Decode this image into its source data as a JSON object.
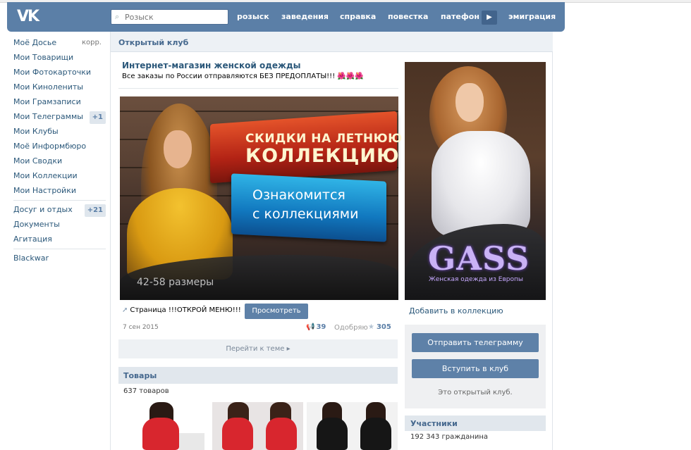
{
  "header": {
    "search_placeholder": "Розыск",
    "nav": [
      "розыск",
      "заведения",
      "справка",
      "повестка",
      "патефон",
      "эмиграция"
    ]
  },
  "sidebar": {
    "items": [
      {
        "label": "Моё Досье",
        "extra": "корр."
      },
      {
        "label": "Мои Товарищи"
      },
      {
        "label": "Мои Фотокарточки"
      },
      {
        "label": "Мои Кинолениты"
      },
      {
        "label": "Мои Грамзаписи"
      },
      {
        "label": "Мои Телеграммы",
        "badge": "+1"
      },
      {
        "label": "Мои Клубы"
      },
      {
        "label": "Моё Информбюро"
      },
      {
        "label": "Мои Сводки"
      },
      {
        "label": "Мои Коллекции"
      },
      {
        "label": "Мои Настройки"
      }
    ],
    "items2": [
      {
        "label": "Досуг и отдых",
        "badge": "+21"
      },
      {
        "label": "Документы"
      },
      {
        "label": "Агитация"
      }
    ],
    "items3": [
      {
        "label": "Blackwar"
      }
    ]
  },
  "main": {
    "header_title": "Открытый клуб",
    "club_title": "Интернет-магазин женской одежды",
    "club_status": "Все заказы по России отправляются БЕЗ ПРЕДОПЛАТЫ!!! 🌺🌺🌺",
    "banner": {
      "line1": "СКИДКИ НА ЛЕТНЮЮ",
      "line2": "КОЛЛЕКЦИЮ",
      "line3": "Ознакомится",
      "line4": "с коллекциями",
      "sizes": "42-58 размеры"
    },
    "page_link": "Страница !!!ОТКРОЙ МЕНЮ!!!",
    "view_button": "Просмотреть",
    "post_date": "7 сен 2015",
    "share_count": "39",
    "like_label": "Одобряю",
    "like_count": "305",
    "goto": "Перейти к теме",
    "goods_title": "Товары",
    "goods_count": "637 товаров"
  },
  "right": {
    "logo_text": "GASS",
    "logo_sub": "Женская одежда из Европы",
    "add_collection": "Добавить в коллекцию",
    "send_telegram": "Отправить телеграмму",
    "join_club": "Вступить в клуб",
    "open_club_note": "Это открытый клуб.",
    "members_title": "Участники",
    "members_count": "192 343 гражданина"
  }
}
